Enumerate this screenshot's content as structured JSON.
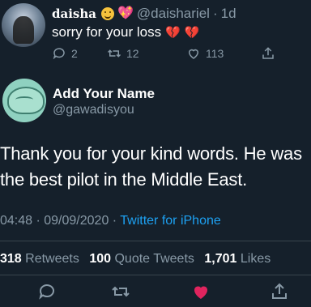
{
  "reply_tweet": {
    "display_name": "daisha",
    "emojis": [
      "smiling-face-icon",
      "sparkling-heart-icon"
    ],
    "handle": "@daishariel",
    "separator": "·",
    "age": "1d",
    "text": "sorry for your loss",
    "text_emojis": [
      "broken-heart-icon",
      "broken-heart-icon"
    ],
    "replies": "2",
    "retweets": "12",
    "likes": "113"
  },
  "main_tweet": {
    "display_name": "Add Your Name",
    "handle": "@gawadisyou",
    "text": "Thank you for your kind words. He was the best pilot in the Middle East.",
    "time": "04:48 · 09/09/2020 ·",
    "source": "Twitter for iPhone",
    "stats": {
      "retweets_count": "318",
      "retweets_label": "Retweets",
      "quote_count": "100",
      "quote_label": "Quote Tweets",
      "likes_count": "1,701",
      "likes_label": "Likes"
    },
    "liked": true
  },
  "colors": {
    "background": "#15202b",
    "secondary_text": "#8899a6",
    "link": "#1da1f2",
    "like_active": "#e0245e",
    "broken_heart": "#d1253d"
  }
}
